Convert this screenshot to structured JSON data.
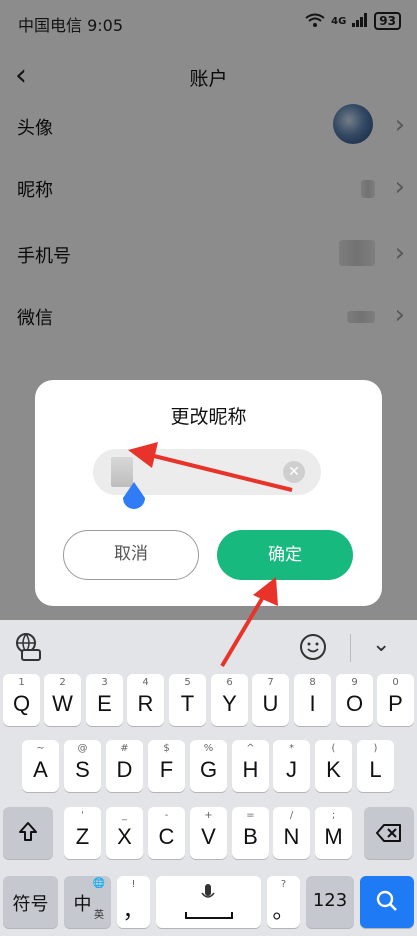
{
  "status_bar": {
    "carrier_time": "中国电信 9:05",
    "signal": "4G",
    "battery": "93"
  },
  "nav": {
    "title": "账户"
  },
  "rows": [
    {
      "label": "头像"
    },
    {
      "label": "昵称"
    },
    {
      "label": "手机号"
    },
    {
      "label": "微信"
    }
  ],
  "dialog": {
    "title": "更改昵称",
    "cancel_label": "取消",
    "confirm_label": "确定"
  },
  "keyboard": {
    "row1": [
      {
        "main": "Q",
        "sub": "1"
      },
      {
        "main": "W",
        "sub": "2"
      },
      {
        "main": "E",
        "sub": "3"
      },
      {
        "main": "R",
        "sub": "4"
      },
      {
        "main": "T",
        "sub": "5"
      },
      {
        "main": "Y",
        "sub": "6"
      },
      {
        "main": "U",
        "sub": "7"
      },
      {
        "main": "I",
        "sub": "8"
      },
      {
        "main": "O",
        "sub": "9"
      },
      {
        "main": "P",
        "sub": "0"
      }
    ],
    "row2": [
      {
        "main": "A",
        "sub": "~"
      },
      {
        "main": "S",
        "sub": "@"
      },
      {
        "main": "D",
        "sub": "#"
      },
      {
        "main": "F",
        "sub": "$"
      },
      {
        "main": "G",
        "sub": "%"
      },
      {
        "main": "H",
        "sub": "^"
      },
      {
        "main": "J",
        "sub": "*"
      },
      {
        "main": "K",
        "sub": "("
      },
      {
        "main": "L",
        "sub": ")"
      }
    ],
    "row3": [
      {
        "main": "Z",
        "sub": "'"
      },
      {
        "main": "X",
        "sub": "_"
      },
      {
        "main": "C",
        "sub": "-"
      },
      {
        "main": "V",
        "sub": "+"
      },
      {
        "main": "B",
        "sub": "="
      },
      {
        "main": "N",
        "sub": "/"
      },
      {
        "main": "M",
        "sub": ";"
      }
    ],
    "symbols_label": "符号",
    "lang_label": "中",
    "lang_sub": "英",
    "comma_label": "，",
    "comma_sub": "!",
    "period_label": "。",
    "period_sub": "?",
    "num_label": "123"
  }
}
